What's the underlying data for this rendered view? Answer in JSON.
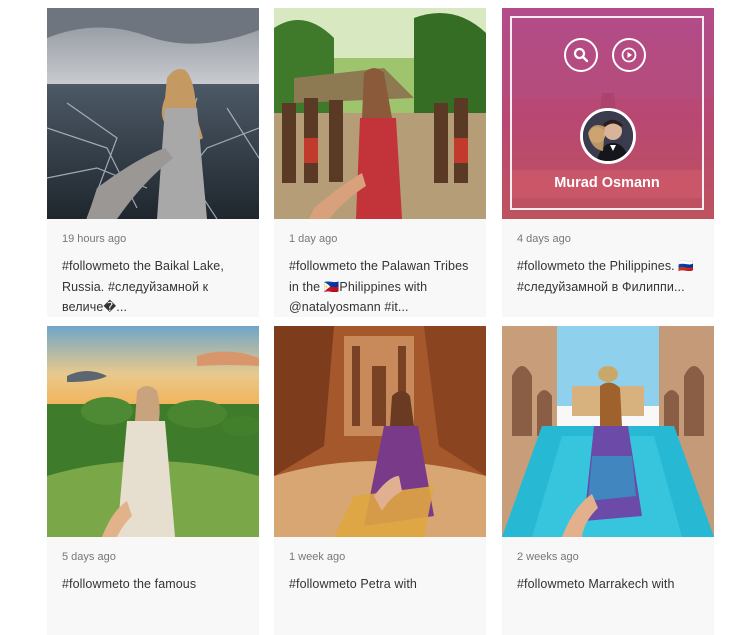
{
  "cards": [
    {
      "time": "19 hours ago",
      "caption": "#followmeto the Baikal Lake, Russia. #следуйзамной к величе�..."
    },
    {
      "time": "1 day ago",
      "caption": "#followmeto the Palawan Tribes in the 🇵🇭Philippines with @natalyosmann #it..."
    },
    {
      "time": "4 days ago",
      "caption": "#followmeto the Philippines. 🇷🇺#следуйзамной в Филиппи...",
      "overlay_name": "Murad Osmann"
    },
    {
      "time": "5 days ago",
      "caption": "#followmeto the famous"
    },
    {
      "time": "1 week ago",
      "caption": "#followmeto Petra with"
    },
    {
      "time": "2 weeks ago",
      "caption": "#followmeto Marrakech with"
    }
  ],
  "icons": {
    "search": "search-icon",
    "play": "play-icon",
    "avatar": "avatar"
  },
  "colors": {
    "overlay": "#c84c88",
    "text": "#333333",
    "time": "#777777"
  }
}
